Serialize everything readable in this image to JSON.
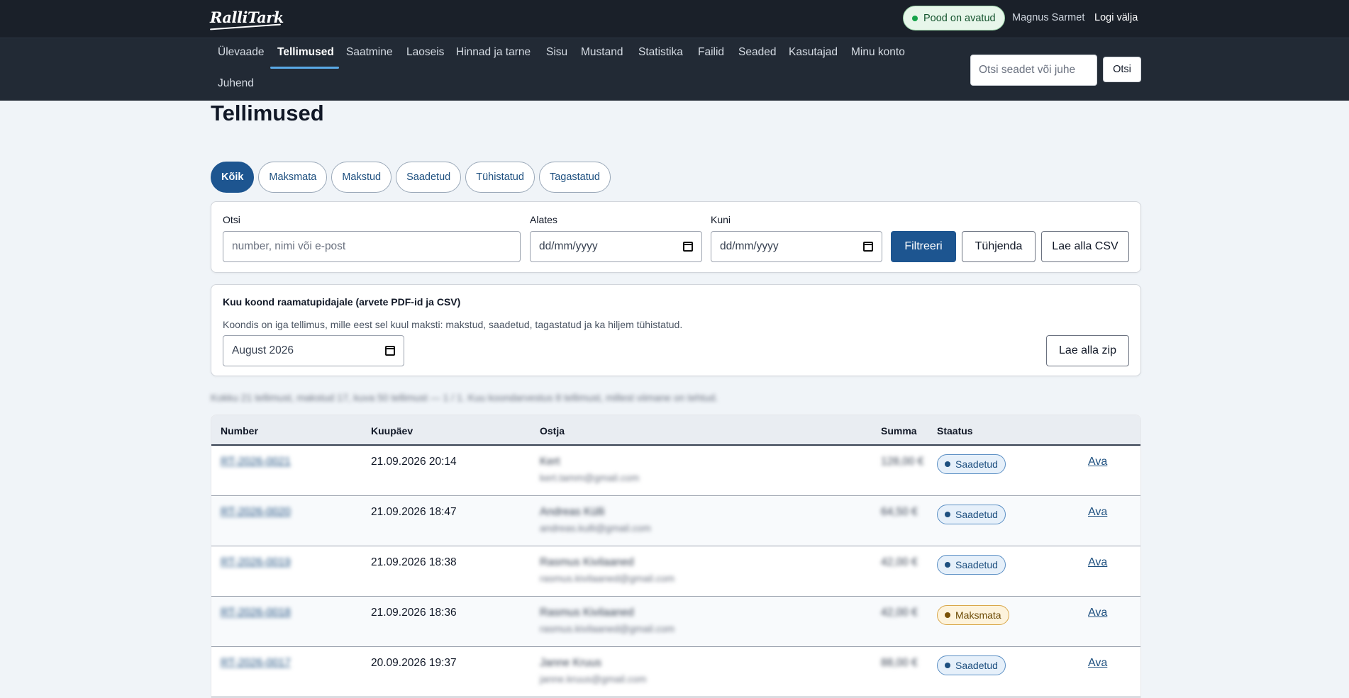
{
  "brand": {
    "logo_text": "RalliTark"
  },
  "topbar": {
    "store_status": "Pood on avatud",
    "user_name": "Magnus Sarmet",
    "logout_label": "Logi välja"
  },
  "nav": {
    "items": [
      "Ülevaade",
      "Tellimused",
      "Saatmine",
      "Laoseis",
      "Hinnad ja tarne",
      "Sisu",
      "Mustand",
      "Statistika",
      "Failid",
      "Seaded",
      "Kasutajad",
      "Minu konto",
      "Juhend"
    ],
    "active": "Tellimused",
    "search_placeholder": "Otsi seadet või juhe",
    "search_button": "Otsi"
  },
  "page": {
    "title": "Tellimused",
    "tabs": [
      "Kõik",
      "Maksmata",
      "Makstud",
      "Saadetud",
      "Tühistatud",
      "Tagastatud"
    ],
    "active_tab": "Kõik"
  },
  "filters": {
    "search_label": "Otsi",
    "search_placeholder": "number, nimi või e-post",
    "from_label": "Alates",
    "from_placeholder": "dd/mm/yyyy",
    "to_label": "Kuni",
    "to_placeholder": "dd/mm/yyyy",
    "filter_button": "Filtreeri",
    "clear_button": "Tühjenda",
    "csv_button": "Lae alla CSV"
  },
  "monthly": {
    "title": "Kuu koond raamatupidajale (arvete PDF-id ja CSV)",
    "description": "Koondis on iga tellimus, mille eest sel kuul maksti: makstud, saadetud, tagastatud ja ka hiljem tühistatud.",
    "month_value": "August  2026",
    "zip_button": "Lae alla zip"
  },
  "summary_text": "Kokku 21 tellimust, makstud 17, kuva 50 tellimust — 1 / 1. Kuu koondarvestus 8 tellimust, millest viimane on tehtud.",
  "table": {
    "headers": {
      "number": "Number",
      "date": "Kuupäev",
      "buyer": "Ostja",
      "sum": "Summa",
      "status": "Staatus"
    },
    "rows": [
      {
        "number": "RT-2026-0021",
        "date": "21.09.2026 20:14",
        "buyer_name": "Kert",
        "buyer_email": "kert.tamm@gmail.com",
        "sum": "128,00 €",
        "status": "Saadetud",
        "status_type": "sent",
        "action": "Ava"
      },
      {
        "number": "RT-2026-0020",
        "date": "21.09.2026 18:47",
        "buyer_name": "Andreas Külli",
        "buyer_email": "andreas.kulli@gmail.com",
        "sum": "64,50 €",
        "status": "Saadetud",
        "status_type": "sent",
        "action": "Ava"
      },
      {
        "number": "RT-2026-0019",
        "date": "21.09.2026 18:38",
        "buyer_name": "Rasmus Kivilaaned",
        "buyer_email": "rasmus.kivilaaned@gmail.com",
        "sum": "42,00 €",
        "status": "Saadetud",
        "status_type": "sent",
        "action": "Ava"
      },
      {
        "number": "RT-2026-0018",
        "date": "21.09.2026 18:36",
        "buyer_name": "Rasmus Kivilaaned",
        "buyer_email": "rasmus.kivilaaned@gmail.com",
        "sum": "42,00 €",
        "status": "Maksmata",
        "status_type": "unpaid",
        "action": "Ava"
      },
      {
        "number": "RT-2026-0017",
        "date": "20.09.2026 19:37",
        "buyer_name": "Janne Kruus",
        "buyer_email": "janne.kruus@gmail.com",
        "sum": "88,00 €",
        "status": "Saadetud",
        "status_type": "sent",
        "action": "Ava"
      }
    ]
  }
}
